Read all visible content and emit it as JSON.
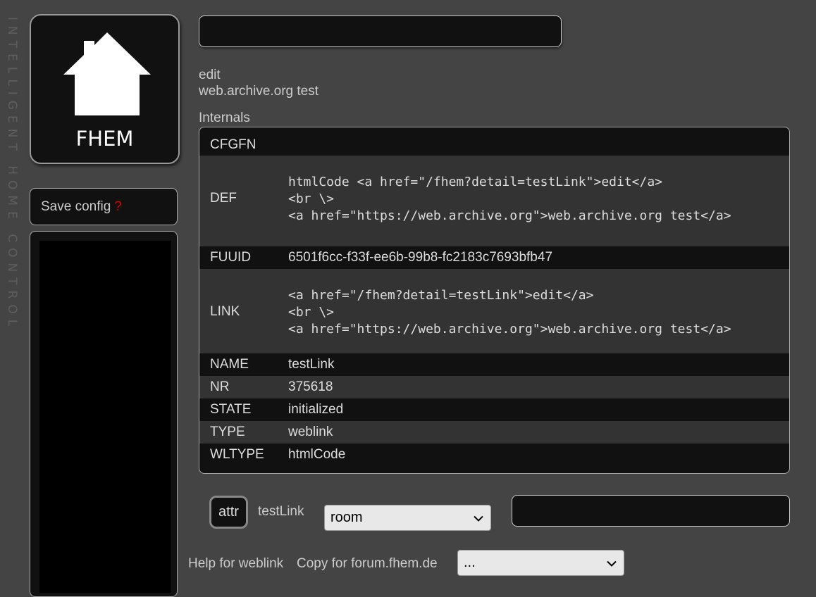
{
  "sidebar": {
    "side_text": "INTELLIGENT HOME CONTROL",
    "logo_text": "FHEM",
    "save_config": "Save config",
    "save_config_marker": "?"
  },
  "command": {
    "value": "",
    "placeholder": ""
  },
  "links": {
    "edit": "edit",
    "web_archive": "web.archive.org test"
  },
  "internals": {
    "title": "Internals",
    "rows": [
      {
        "key": "CFGFN",
        "value": ""
      },
      {
        "key": "DEF",
        "value": "htmlCode <a href=\"/fhem?detail=testLink\">edit</a>\n<br \\>\n<a href=\"https://web.archive.org\">web.archive.org test</a>"
      },
      {
        "key": "FUUID",
        "value": "6501f6cc-f33f-ee6b-99b8-fc2183c7693bfb47"
      },
      {
        "key": "LINK",
        "value": "<a href=\"/fhem?detail=testLink\">edit</a>\n<br \\>\n<a href=\"https://web.archive.org\">web.archive.org test</a>"
      },
      {
        "key": "NAME",
        "value": "testLink"
      },
      {
        "key": "NR",
        "value": "375618"
      },
      {
        "key": "STATE",
        "value": "initialized"
      },
      {
        "key": "TYPE",
        "value": "weblink"
      },
      {
        "key": "WLTYPE",
        "value": "htmlCode"
      }
    ]
  },
  "attr": {
    "button": "attr",
    "device": "testLink",
    "selected": "room",
    "value": ""
  },
  "footer": {
    "help": "Help for weblink",
    "copy": "Copy for forum.fhem.de",
    "copy_selected": "..."
  }
}
